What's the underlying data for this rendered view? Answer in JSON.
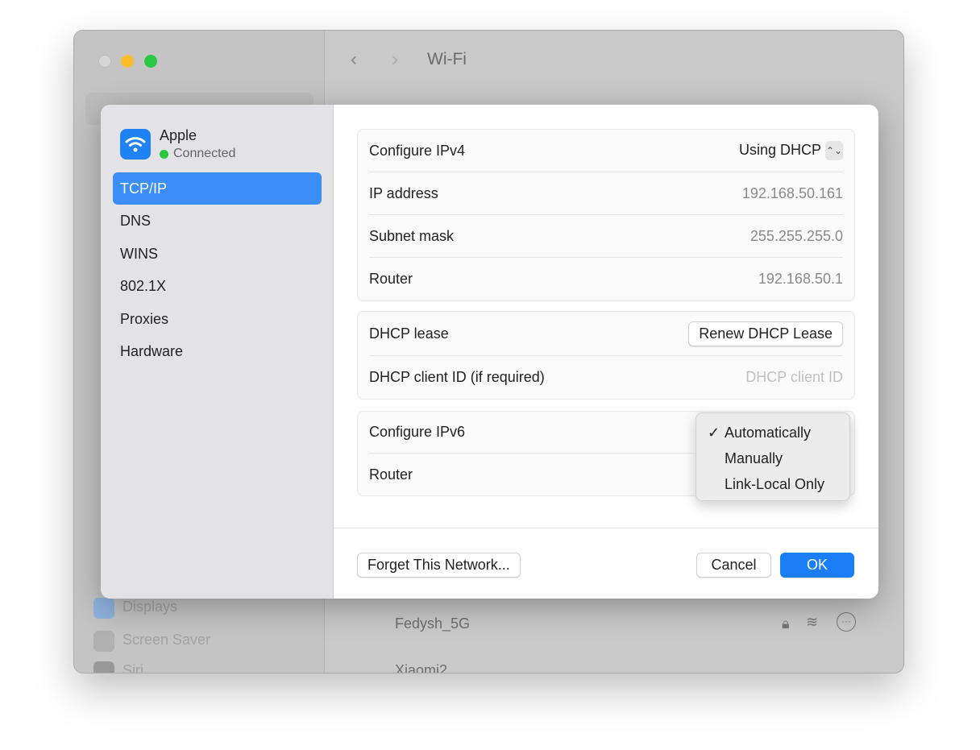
{
  "background_window": {
    "title": "Wi-Fi",
    "sidebar_items": [
      "Displays",
      "Screen Saver",
      "Siri"
    ],
    "networks": [
      "Fedysh_5G",
      "Xiaomi2"
    ]
  },
  "dialog": {
    "network_name": "Apple",
    "network_status": "Connected",
    "sidebar": [
      {
        "label": "TCP/IP",
        "selected": true
      },
      {
        "label": "DNS"
      },
      {
        "label": "WINS"
      },
      {
        "label": "802.1X"
      },
      {
        "label": "Proxies"
      },
      {
        "label": "Hardware"
      }
    ],
    "ipv4": {
      "configure_label": "Configure IPv4",
      "configure_value": "Using DHCP",
      "ip_label": "IP address",
      "ip_value": "192.168.50.161",
      "subnet_label": "Subnet mask",
      "subnet_value": "255.255.255.0",
      "router_label": "Router",
      "router_value": "192.168.50.1"
    },
    "dhcp": {
      "lease_label": "DHCP lease",
      "renew_button": "Renew DHCP Lease",
      "client_id_label": "DHCP client ID (if required)",
      "client_id_placeholder": "DHCP client ID"
    },
    "ipv6": {
      "configure_label": "Configure IPv6",
      "router_label": "Router",
      "options": [
        "Automatically",
        "Manually",
        "Link-Local Only"
      ],
      "selected": "Automatically",
      "check": "✓"
    },
    "buttons": {
      "forget": "Forget This Network...",
      "cancel": "Cancel",
      "ok": "OK"
    }
  },
  "colors": {
    "accent": "#3a8ef6",
    "ok": "#1a7ff7",
    "connected": "#2ac840"
  }
}
